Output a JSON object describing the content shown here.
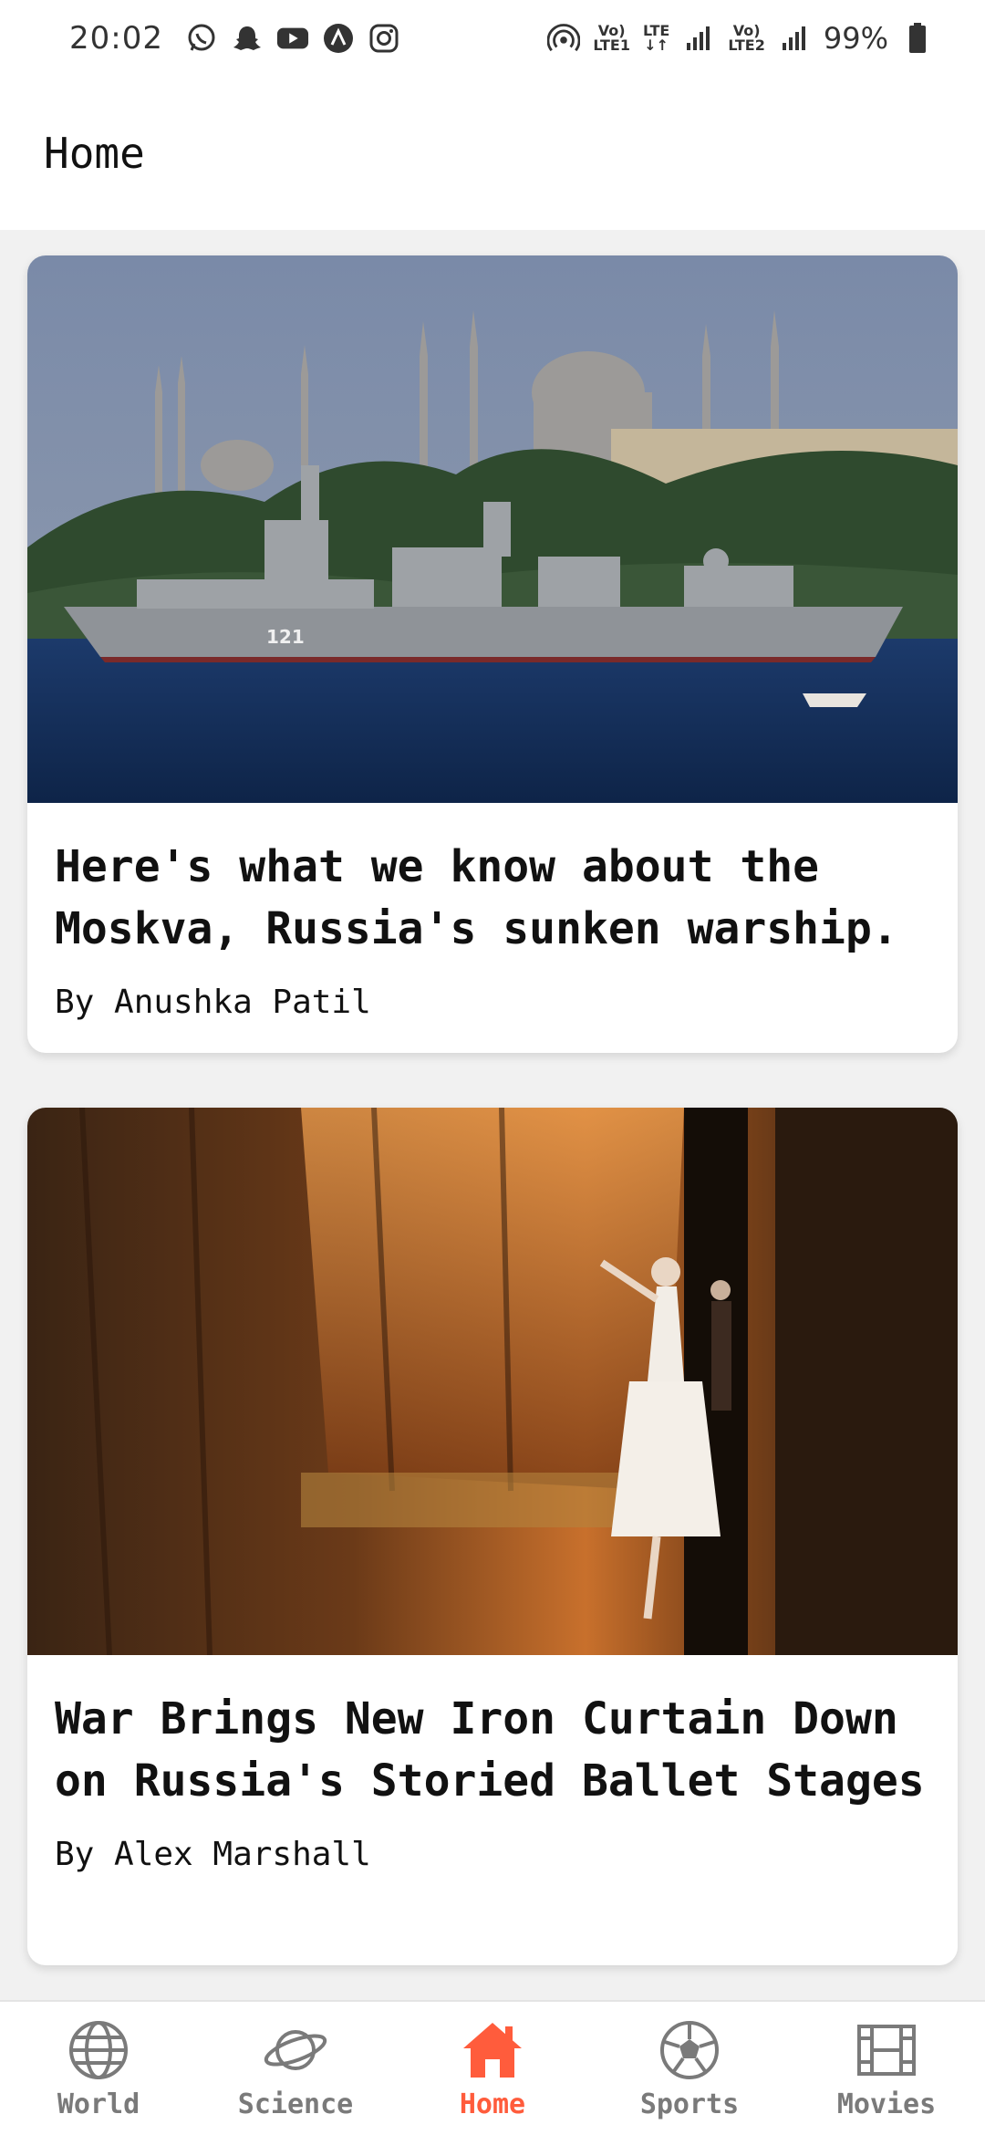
{
  "status_bar": {
    "time": "20:02",
    "notification_icons": [
      "whatsapp-icon",
      "snapchat-icon",
      "youtube-icon",
      "app-icon",
      "instagram-icon"
    ],
    "sim1_label_top": "Vo)",
    "sim1_label_bottom": "LTE1",
    "lte_label": "LTE",
    "sim2_label_top": "Vo)",
    "sim2_label_bottom": "LTE2",
    "battery": "99%"
  },
  "app_bar": {
    "title": "Home"
  },
  "articles": [
    {
      "title": "Here's what we know about the Moskva, Russia's sunken warship.",
      "author": "By Anushka Patil",
      "image_alt": "Warship passing a city skyline with mosques",
      "ship_number": "121"
    },
    {
      "title": "War Brings New Iron Curtain Down on Russia's Storied Ballet Stages",
      "author": "By Alex Marshall",
      "image_alt": "Ballet dancer in white dress beside a golden stage curtain"
    }
  ],
  "bottom_nav": {
    "items": [
      {
        "label": "World",
        "icon": "globe-icon",
        "active": false
      },
      {
        "label": "Science",
        "icon": "planet-icon",
        "active": false
      },
      {
        "label": "Home",
        "icon": "home-icon",
        "active": true
      },
      {
        "label": "Sports",
        "icon": "soccer-ball-icon",
        "active": false
      },
      {
        "label": "Movies",
        "icon": "film-icon",
        "active": false
      }
    ]
  },
  "colors": {
    "accent": "#ff5c3c",
    "inactive": "#7a7a7a",
    "background": "#f1f1f1"
  }
}
